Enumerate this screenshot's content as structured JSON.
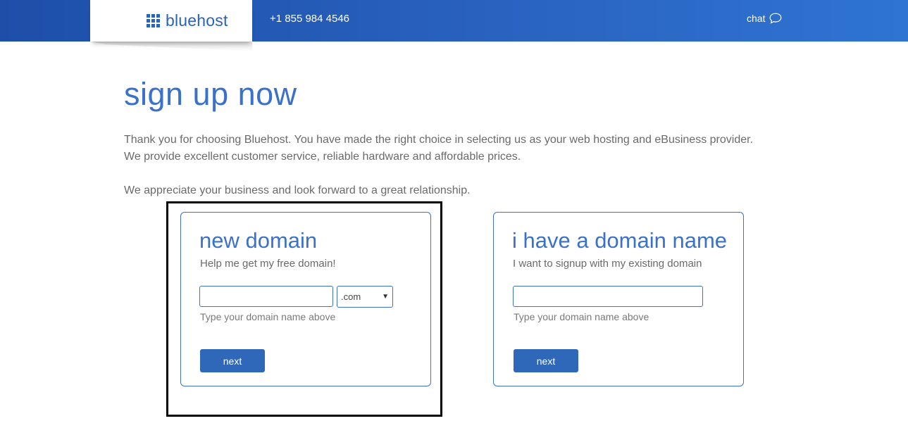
{
  "header": {
    "logo_text": "bluehost",
    "phone": "+1 855 984 4546",
    "chat_label": "chat",
    "brand_color": "#2a62c0"
  },
  "page": {
    "title": "sign up now",
    "intro_line1": "Thank you for choosing Bluehost. You have made the right choice in selecting us as your web hosting and eBusiness provider.",
    "intro_line2": "We provide excellent customer service, reliable hardware and affordable prices.",
    "intro_line3": "We appreciate your business and look forward to a great relationship."
  },
  "new_domain": {
    "title": "new domain",
    "subtitle": "Help me get my free domain!",
    "input_value": "",
    "tld_selected": ".com",
    "hint": "Type your domain name above",
    "button_label": "next"
  },
  "existing_domain": {
    "title": "i have a domain name",
    "subtitle": "I want to signup with my existing domain",
    "input_value": "",
    "hint": "Type your domain name above",
    "button_label": "next"
  },
  "icons": {
    "logo": "grid-logo-icon",
    "chat": "chat-bubble-icon",
    "dropdown": "caret-down-icon"
  },
  "colors": {
    "accent": "#3b72c8",
    "button": "#2f68b8",
    "highlight_border": "#000000"
  }
}
